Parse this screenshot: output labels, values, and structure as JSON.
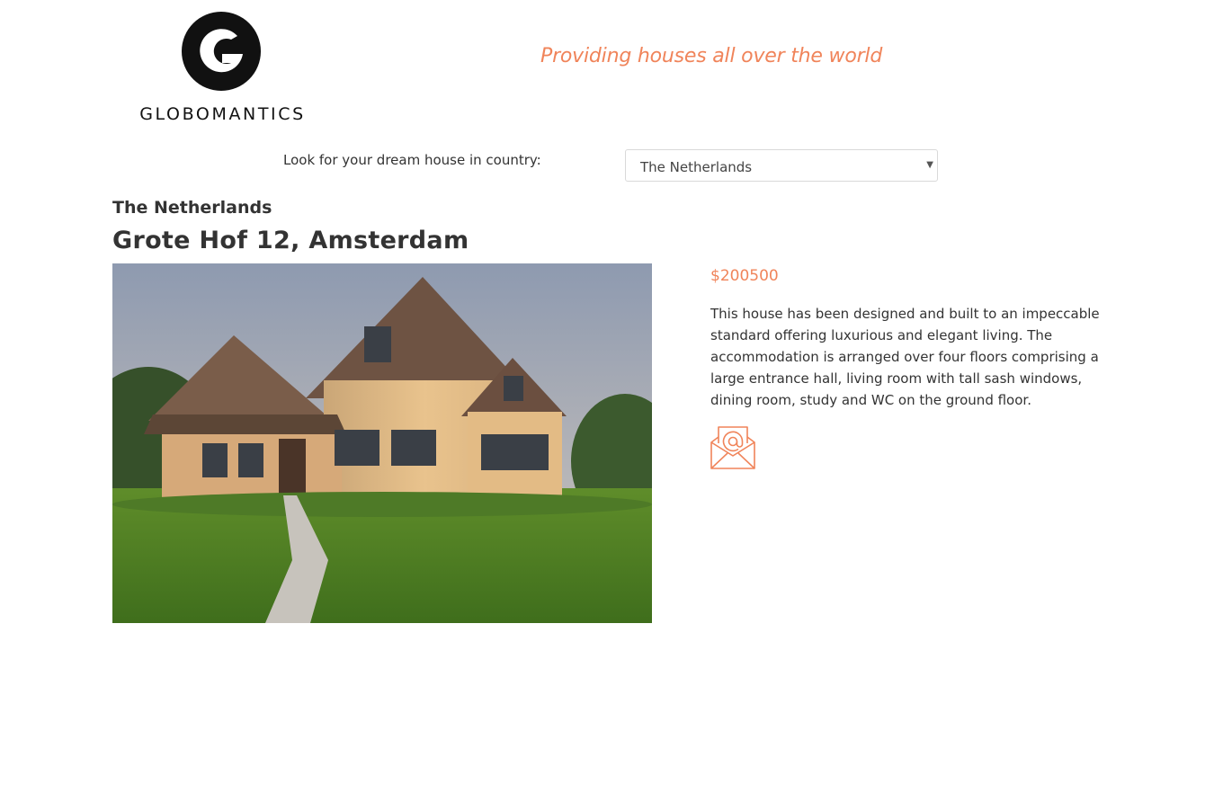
{
  "header": {
    "logo_text": "GLOBOMANTICS",
    "tagline": "Providing houses all over the world"
  },
  "search": {
    "label": "Look for your dream house in country:",
    "selected_country": "The Netherlands"
  },
  "listing": {
    "country": "The Netherlands",
    "address": "Grote Hof 12, Amsterdam",
    "price": "$200500",
    "description": "This house has been designed and built to an impeccable standard offering luxurious and elegant living. The accommodation is arranged over four floors comprising a large entrance hall, living room with tall sash windows, dining room, study and WC on the ground floor.",
    "photo_icon": "house-photo",
    "contact_icon": "email-envelope-icon"
  },
  "colors": {
    "accent": "#f0845a",
    "text": "#333333",
    "logo": "#111111"
  }
}
